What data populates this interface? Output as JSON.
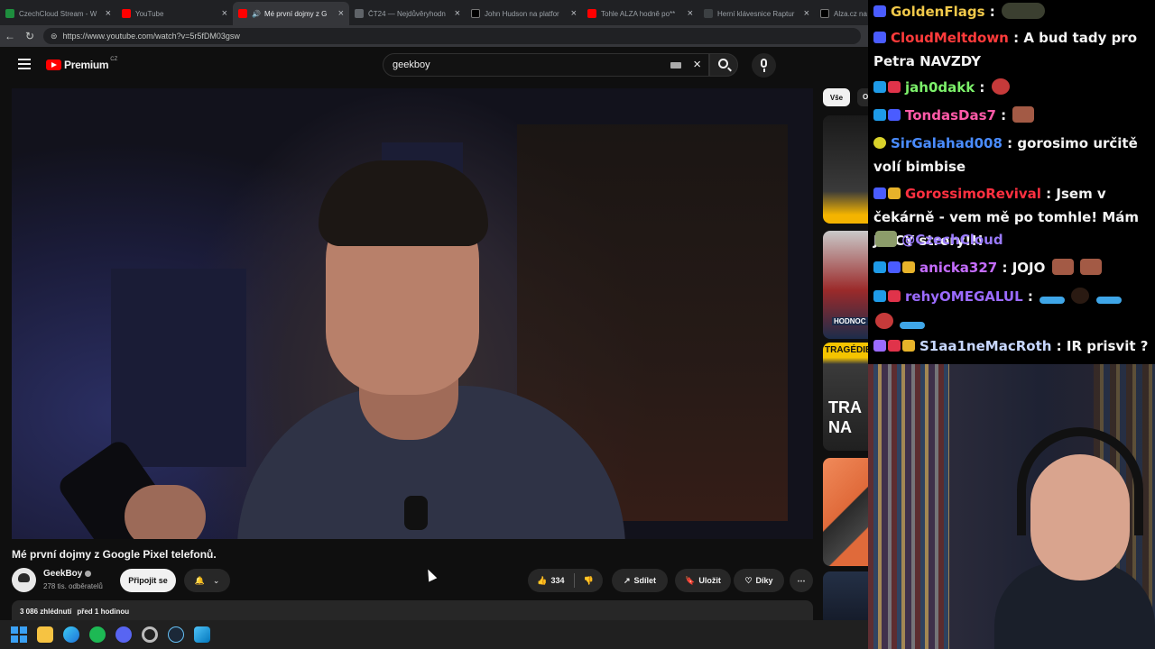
{
  "browser": {
    "tabs": [
      {
        "title": "CzechCloud Stream - W",
        "color": "#1e8e3e",
        "active": false
      },
      {
        "title": "YouTube",
        "color": "#ff0000",
        "active": false
      },
      {
        "title": "Mé první dojmy z G",
        "color": "#ff0000",
        "active": true
      },
      {
        "title": "ČT24 — Nejdůvěryhodn",
        "color": "#5f6368",
        "active": false
      },
      {
        "title": "John Hudson na platfor",
        "color": "#000000",
        "active": false
      },
      {
        "title": "Tohle ALZA hodně po**",
        "color": "#ff0000",
        "active": false
      },
      {
        "title": "Herní klávesnice Raptur",
        "color": "#3c4043",
        "active": false
      },
      {
        "title": "Alza.cz na platfo",
        "color": "#000000",
        "active": false
      }
    ],
    "url": "https://www.youtube.com/watch?v=5r5fDM03gsw"
  },
  "youtube": {
    "logo_text": "Premium",
    "logo_country": "CZ",
    "search_value": "geekboy",
    "video_title": "Mé první dojmy z Google Pixel telefonů.",
    "channel_name": "GeekBoy",
    "subscribers": "278 tis. odběratelů",
    "join_label": "Připojit se",
    "like_count": "334",
    "share_label": "Sdílet",
    "save_label": "Uložit",
    "thanks_label": "Díky",
    "views": "3 086 zhlédnutí",
    "published": "před 1 hodinou",
    "chip_all": "Vše",
    "chip_next": "O",
    "thumb_label_1": "HODNOC",
    "thumb_label_2": "TRAGÉDIE",
    "thumb_label_3": "TRA",
    "thumb_label_4": "NA"
  },
  "chat": {
    "messages": [
      {
        "user": "GoldenFlags",
        "color": "#f0c84a",
        "text": ""
      },
      {
        "user": "CloudMeltdown",
        "color": "#ff3b3b",
        "text": "A bud tady pro Petra NAVZDY"
      },
      {
        "user": "jah0dakk",
        "color": "#7cf06a",
        "text": ""
      },
      {
        "user": "TondasDas7",
        "color": "#ff5aa8",
        "text": ""
      },
      {
        "user": "SirGalahad008",
        "color": "#4a8cff",
        "text": "gorosimo určitě volí bimbise"
      },
      {
        "user": "GorossimoRevival",
        "color": "#ff3040",
        "text": "Jsem v čekárně - vem mě po tomhle! Mám JUICY strory!!!"
      },
      {
        "user": "",
        "color": "#9b7bff",
        "text": "@CzechCloud"
      },
      {
        "user": "anicka327",
        "color": "#c46cff",
        "text": "JOJO"
      },
      {
        "user": "rehyOMEGALUL",
        "color": "#9b6bff",
        "text": ""
      },
      {
        "user": "S1aa1neMacRoth",
        "color": "#c8d8ff",
        "text": "IR prisvit ?"
      }
    ]
  }
}
